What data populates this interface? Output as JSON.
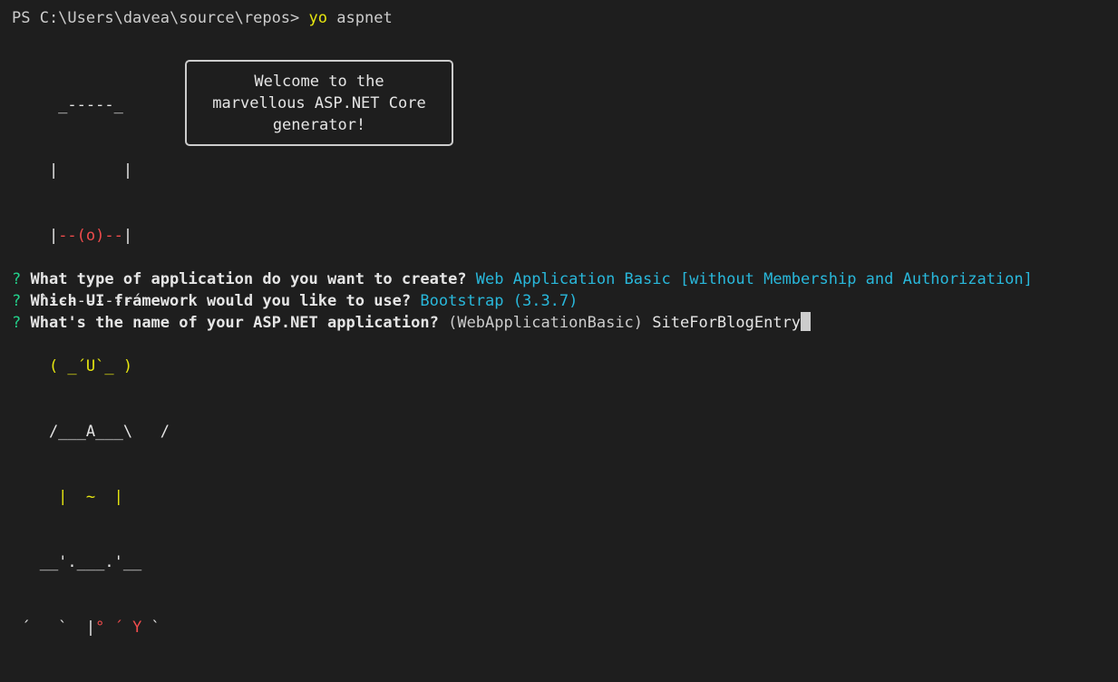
{
  "terminal": {
    "prompt": "PS C:\\Users\\davea\\source\\repos>",
    "command": "yo",
    "command_args": "aspnet"
  },
  "ascii_art": {
    "rows": [
      {
        "c": "white",
        "t": "     _-----_"
      },
      {
        "c": "white",
        "t": "    |       |"
      },
      {
        "c": "white",
        "t": "    |",
        "c2": "red",
        "t2": "--(o)--",
        "c3": "white",
        "t3": "|"
      },
      {
        "c": "white",
        "t": "   `---------´"
      },
      {
        "c": "yellow",
        "t": "    ( _´U`_ )"
      },
      {
        "c": "white",
        "t": "    /___A___\\   /"
      },
      {
        "c": "yellow",
        "t": "     |  ~  |"
      },
      {
        "c": "white",
        "t": "   __'.___.'__"
      },
      {
        "c": "white",
        "t": " ´   `  |",
        "c2": "red",
        "t2": "° ´ Y",
        "c3": "white",
        "t3": " `"
      }
    ]
  },
  "welcome": {
    "line1": "Welcome to the",
    "line2": "marvellous ASP.NET Core",
    "line3": "generator!"
  },
  "questions": [
    {
      "marker": "?",
      "text": "What type of application do you want to create?",
      "answer": "Web Application Basic [without Membership and Authorization]"
    },
    {
      "marker": "?",
      "text": "Which UI framework would you like to use?",
      "answer": "Bootstrap (3.3.7)"
    },
    {
      "marker": "?",
      "text": "What's the name of your ASP.NET application?",
      "default": "(WebApplicationBasic)",
      "input": "SiteForBlogEntry"
    }
  ],
  "colors": {
    "background": "#1e1e1e",
    "foreground": "#cccccc",
    "yellow": "#e5e510",
    "red": "#f14c4c",
    "green": "#23d18b",
    "cyan": "#29b8db"
  }
}
